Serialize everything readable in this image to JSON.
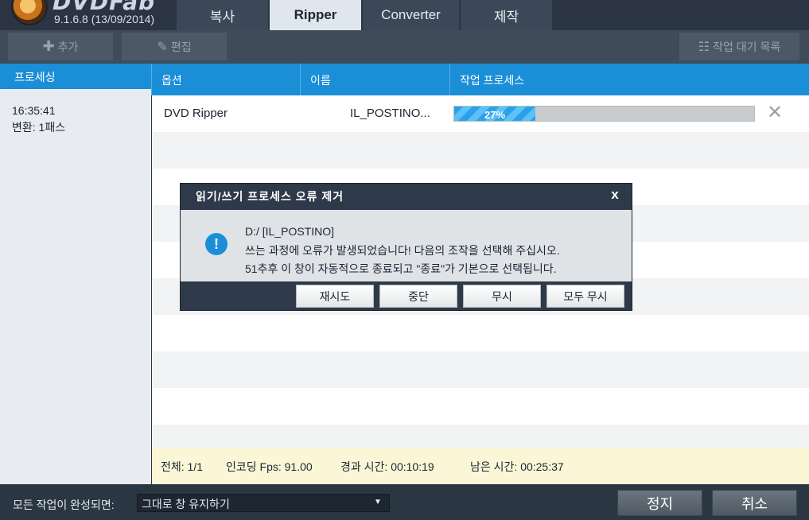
{
  "header": {
    "version": "9.1.6.8 (13/09/2014)",
    "logo_text": "DVDFab",
    "tabs": [
      {
        "label": "복사"
      },
      {
        "label": "Ripper"
      },
      {
        "label": "Converter"
      },
      {
        "label": "제작"
      }
    ]
  },
  "toolbar": {
    "add_label": "추가",
    "edit_label": "편집",
    "queue_label": "작업 대기 목록"
  },
  "left_panel": {
    "header": "프로세싱",
    "time": "16:35:41",
    "mode": "변환: 1패스"
  },
  "table": {
    "columns": [
      "옵션",
      "이름",
      "작업 프로세스"
    ],
    "rows": [
      {
        "option": "DVD Ripper",
        "name": "IL_POSTINO...",
        "progress_text": "27%",
        "progress": 27
      }
    ]
  },
  "status": {
    "total": "전체: 1/1",
    "fps": "인코딩 Fps: 91.00",
    "elapsed": "경과 시간: 00:10:19",
    "remaining": "남은 시간: 00:25:37"
  },
  "bottom": {
    "label": "모든 작업이 완성되면:",
    "select_value": "그대로 창 유지하기",
    "stop_label": "정지",
    "cancel_label": "취소"
  },
  "dialog": {
    "title": "읽기/쓰기 프로세스 오류 제거",
    "close": "x",
    "path": "D:/ [IL_POSTINO]",
    "message1": "쓰는 과정에 오류가 발생되었습니다! 다음의 조작을 선택해 주십시오.",
    "message2": "51추후 이 창이 자동적으로 종료되고 \"종료\"가 기본으로 선택됩니다.",
    "buttons": [
      "재시도",
      "중단",
      "무시",
      "모두 무시"
    ]
  },
  "colors": {
    "accent": "#1b8ed8",
    "header_bg": "#2b3442",
    "status_bg": "#fbf7d6"
  }
}
